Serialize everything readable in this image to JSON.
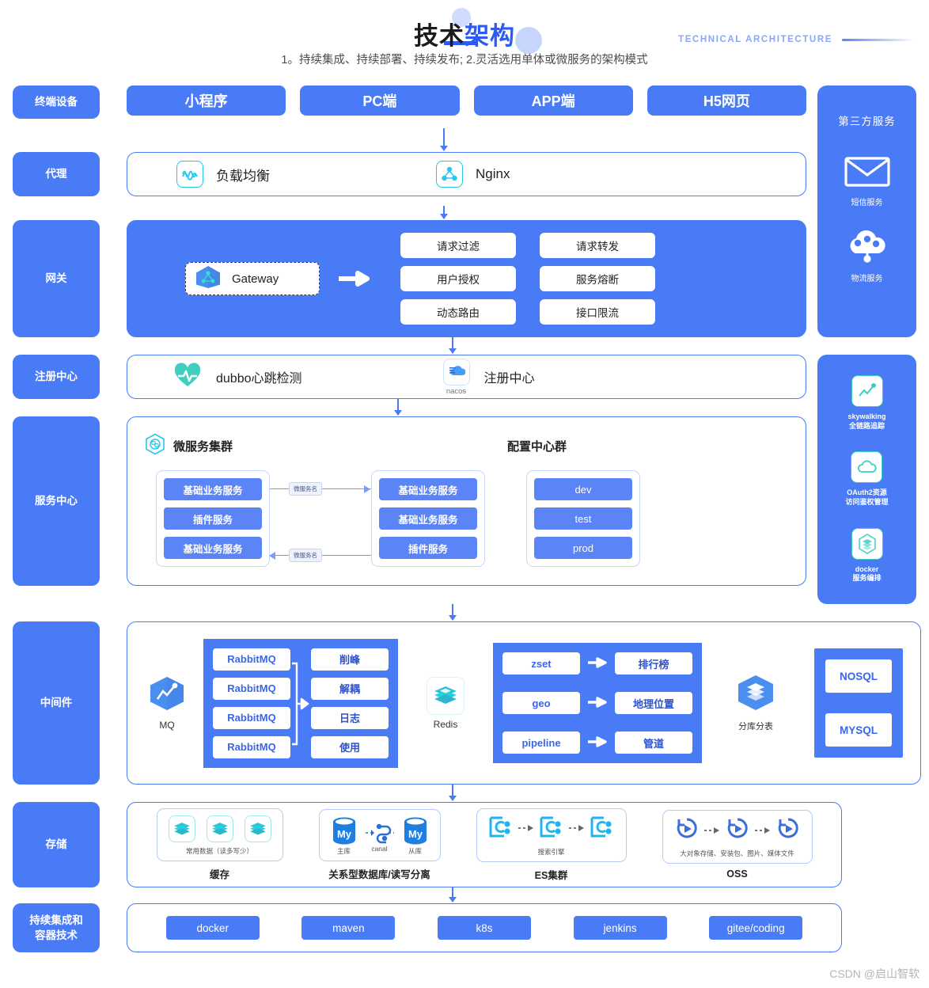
{
  "header": {
    "title_dark": "技术",
    "title_blue": "架构",
    "subtitle": "1。持续集成、持续部署、持续发布; 2.灵活选用单体或微服务的架构模式",
    "english": "TECHNICAL ARCHITECTURE"
  },
  "colors": {
    "primary_blue": "#4a7bf7",
    "deep_blue": "#2a5bf5",
    "cyan": "#22c8ee",
    "teal": "#3ecfc0",
    "panel_border": "#4a7bf7"
  },
  "rows": {
    "terminal": {
      "label": "终端设备",
      "items": [
        {
          "label": "小程序"
        },
        {
          "label": "PC端"
        },
        {
          "label": "APP端"
        },
        {
          "label": "H5网页"
        }
      ]
    },
    "proxy": {
      "label": "代理",
      "items": [
        {
          "icon": "wave-icon",
          "label": "负载均衡"
        },
        {
          "icon": "nginx-node-icon",
          "label": "Nginx"
        }
      ]
    },
    "gateway": {
      "label": "网关",
      "chip_label": "Gateway",
      "chip_icon": "hexagon-gateway-icon",
      "cells_left": [
        "请求过滤",
        "用户授权",
        "动态路由"
      ],
      "cells_right": [
        "请求转发",
        "服务熔断",
        "接口限流"
      ]
    },
    "registry": {
      "label": "注册中心",
      "items": [
        {
          "icon": "heartbeat-icon",
          "label": "dubbo心跳检测",
          "caption": ""
        },
        {
          "icon": "nacos-icon",
          "label": "注册中心",
          "caption": "nacos"
        }
      ]
    },
    "service_center": {
      "label": "服务中心",
      "cluster_title": "微服务集群",
      "cluster_icon": "microservice-hex-icon",
      "config_title": "配置中心群",
      "left_group": [
        "基础业务服务",
        "插件服务",
        "基础业务服务"
      ],
      "right_group": [
        "基础业务服务",
        "基础业务服务",
        "插件服务"
      ],
      "config_group": [
        "dev",
        "test",
        "prod"
      ],
      "edge_label_top": "微服务名",
      "edge_label_bottom": "微服务名"
    },
    "middleware": {
      "label": "中间件",
      "mq": {
        "icon": "mq-hexagon-icon",
        "caption": "MQ",
        "sources": [
          "RabbitMQ",
          "RabbitMQ",
          "RabbitMQ",
          "RabbitMQ"
        ],
        "targets": [
          "削峰",
          "解耦",
          "日志",
          "使用"
        ]
      },
      "redis": {
        "icon": "redis-icon",
        "caption": "Redis",
        "pairs": [
          {
            "from": "zset",
            "to": "排行榜"
          },
          {
            "from": "geo",
            "to": "地理位置"
          },
          {
            "from": "pipeline",
            "to": "管道"
          }
        ]
      },
      "sharding": {
        "icon": "sharding-hexagon-icon",
        "caption": "分库分表"
      },
      "db": [
        "NOSQL",
        "MYSQL"
      ]
    },
    "storage": {
      "label": "存储",
      "groups": [
        {
          "caption": "缓存",
          "inner_caption": "常用数据（读多写少）",
          "icon": "redis-stack-icon",
          "count": 3
        },
        {
          "caption": "关系型数据库/读写分离",
          "inner_caption": "",
          "icon": "mysql-icon",
          "nodes": [
            "主库",
            "canal",
            "从库"
          ]
        },
        {
          "caption": "ES集群",
          "inner_caption": "搜索引擎",
          "icon": "elastic-icon",
          "count": 3
        },
        {
          "caption": "OSS",
          "inner_caption": "大对象存储、安装包、图片、媒体文件",
          "icon": "oss-icon",
          "count": 3
        }
      ]
    },
    "ci": {
      "label": "持续集成和\n容器技术",
      "label_line1": "持续集成和",
      "label_line2": "容器技术",
      "items": [
        "docker",
        "maven",
        "k8s",
        "jenkins",
        "gitee/coding"
      ]
    }
  },
  "sidecols": {
    "third_party": {
      "title": "第三方服务",
      "items": [
        {
          "icon": "mail-icon",
          "caption": "短信服务"
        },
        {
          "icon": "logistics-cloud-icon",
          "caption": "物流服务"
        }
      ]
    },
    "tools": {
      "items": [
        {
          "icon": "skywalking-icon",
          "caption_line1": "skywalking",
          "caption_line2": "全链路追踪"
        },
        {
          "icon": "oauth-cloud-icon",
          "caption_line1": "OAuth2资源",
          "caption_line2": "访问鉴权管理"
        },
        {
          "icon": "docker-hex-icon",
          "caption_line1": "docker",
          "caption_line2": "服务编排"
        }
      ]
    }
  },
  "watermark": "CSDN @启山智软"
}
